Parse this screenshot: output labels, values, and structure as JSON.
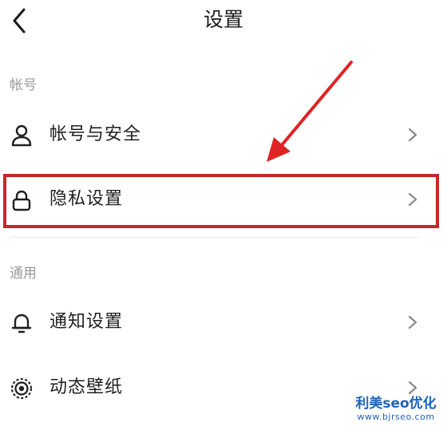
{
  "header": {
    "title": "设置",
    "back_icon": "chevron-left-icon"
  },
  "sections": [
    {
      "label": "帐号",
      "items": [
        {
          "label": "帐号与安全",
          "icon": "user-icon"
        },
        {
          "label": "隐私设置",
          "icon": "lock-icon",
          "highlighted": true
        }
      ]
    },
    {
      "label": "通用",
      "items": [
        {
          "label": "通知设置",
          "icon": "bell-icon"
        },
        {
          "label": "动态壁纸",
          "icon": "live-wallpaper-icon"
        }
      ]
    }
  ],
  "annotation": {
    "arrow_color": "#e02424",
    "box_color": "#c62828"
  },
  "watermark": {
    "brand": "利美seo优化",
    "url": "www.bjrseo.com"
  },
  "colors": {
    "section_label": "#9a9a9a",
    "text": "#1f1f1f",
    "chevron": "#8a8a8a"
  }
}
